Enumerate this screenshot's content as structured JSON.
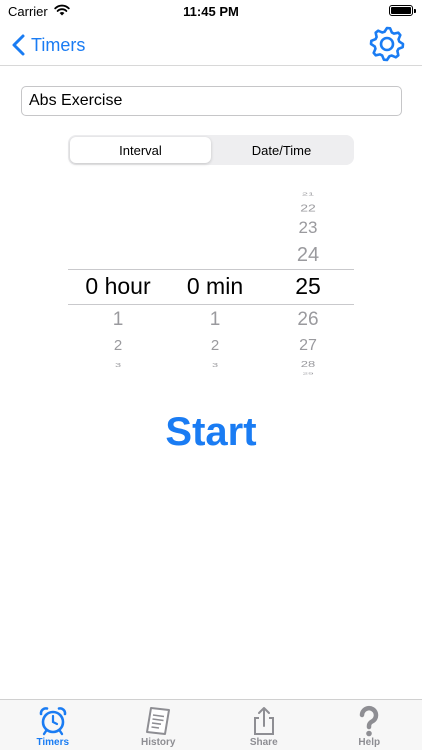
{
  "status_bar": {
    "carrier": "Carrier",
    "time": "11:45 PM"
  },
  "nav": {
    "back_label": "Timers",
    "settings_icon": "gear-icon"
  },
  "timer_name": {
    "value": "Abs Exercise",
    "placeholder": ""
  },
  "mode": {
    "options": [
      "Interval",
      "Date/Time"
    ],
    "selected": "Interval"
  },
  "picker": {
    "hours": {
      "above": [],
      "selected": "0 hour",
      "below": [
        "1",
        "2",
        "3"
      ]
    },
    "minutes": {
      "above": [],
      "selected": "0 min",
      "below": [
        "1",
        "2",
        "3"
      ]
    },
    "seconds": {
      "above": [
        "21",
        "22",
        "23",
        "24"
      ],
      "selected": "25",
      "below": [
        "26",
        "27",
        "28",
        "29"
      ]
    }
  },
  "start_label": "Start",
  "tabs": [
    {
      "label": "Timers",
      "icon": "alarm-clock-icon",
      "active": true
    },
    {
      "label": "History",
      "icon": "receipt-icon",
      "active": false
    },
    {
      "label": "Share",
      "icon": "share-icon",
      "active": false
    },
    {
      "label": "Help",
      "icon": "question-mark-icon",
      "active": false
    }
  ],
  "colors": {
    "accent": "#1a7cf3",
    "inactive": "#8e8e93",
    "separator": "#d8d8d8"
  }
}
